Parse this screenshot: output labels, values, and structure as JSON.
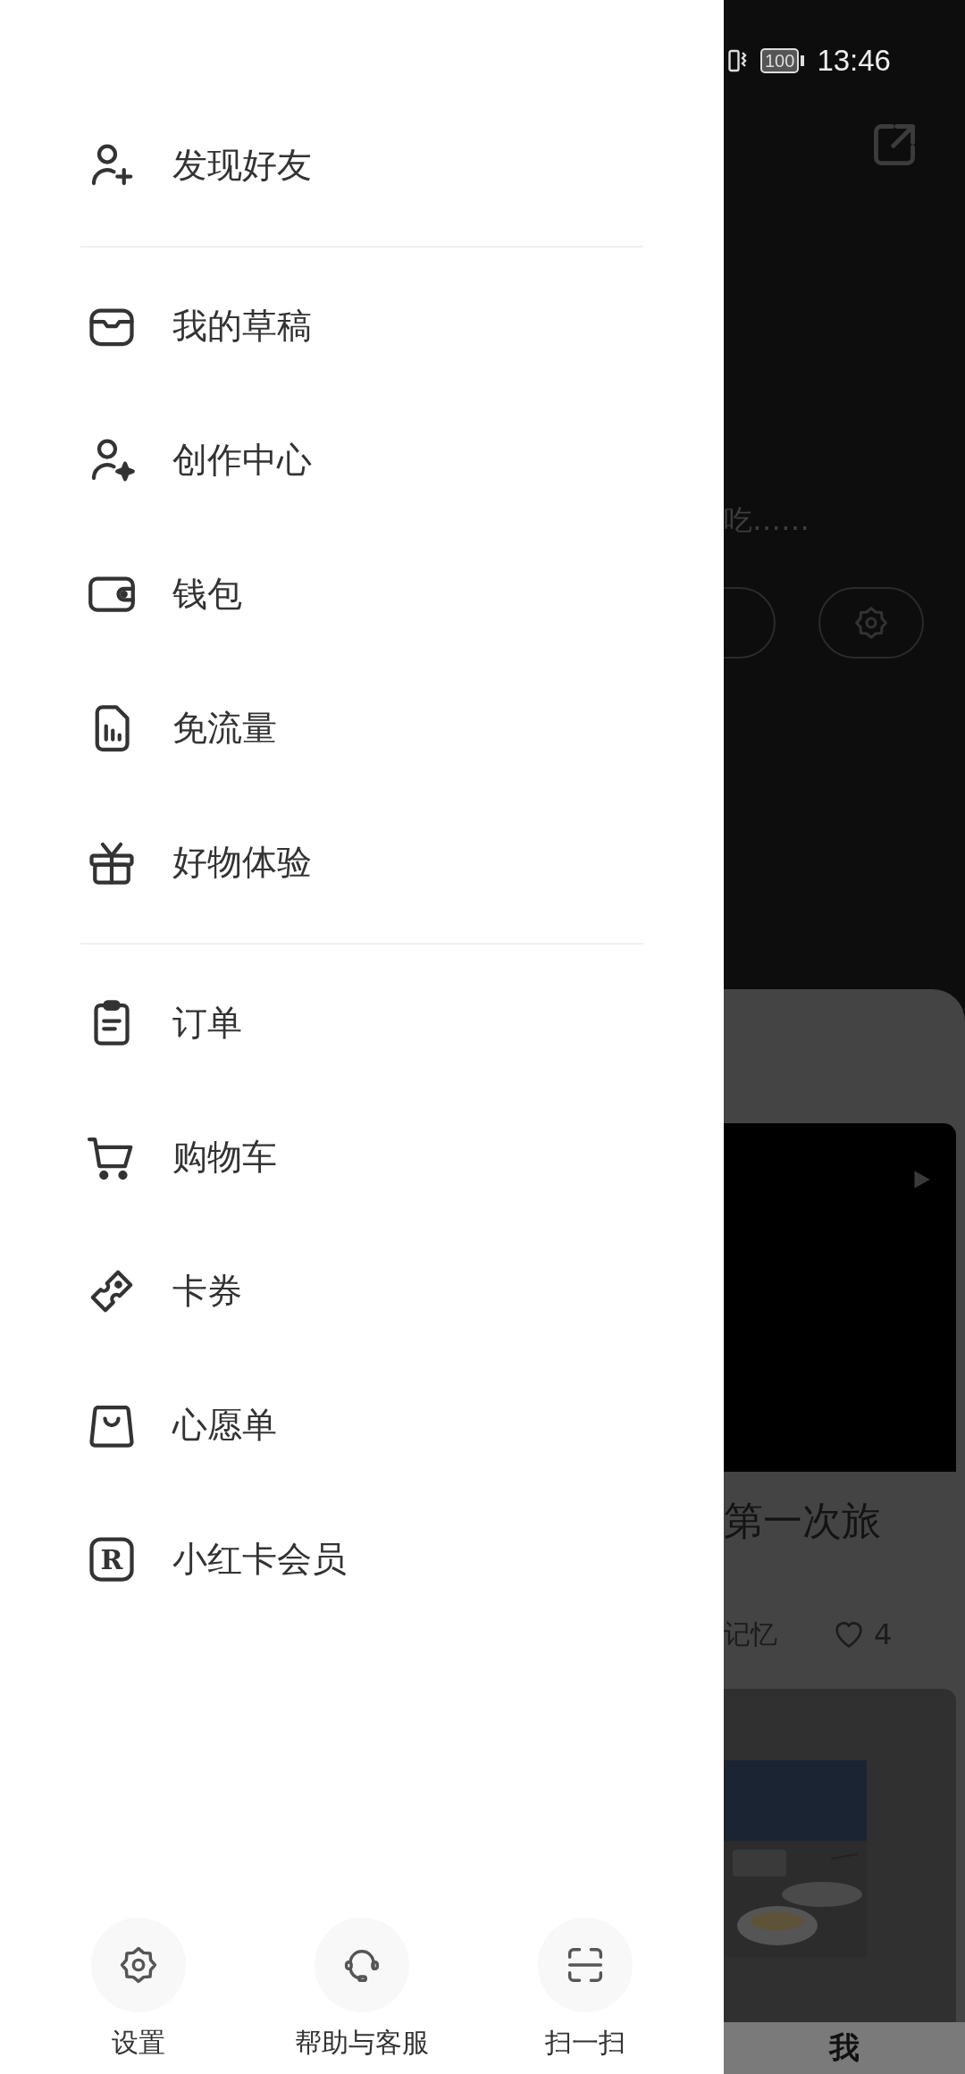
{
  "status_bar": {
    "battery": "100",
    "time": "13:46"
  },
  "drawer": {
    "sections": [
      {
        "items": [
          {
            "label": "发现好友"
          }
        ]
      },
      {
        "items": [
          {
            "label": "我的草稿"
          },
          {
            "label": "创作中心"
          },
          {
            "label": "钱包"
          },
          {
            "label": "免流量"
          },
          {
            "label": "好物体验"
          }
        ]
      },
      {
        "items": [
          {
            "label": "订单"
          },
          {
            "label": "购物车"
          },
          {
            "label": "卡券"
          },
          {
            "label": "心愿单"
          },
          {
            "label": "小红卡会员",
            "icon_text": "R"
          }
        ]
      }
    ],
    "actions": [
      {
        "label": "设置"
      },
      {
        "label": "帮助与客服"
      },
      {
        "label": "扫一扫"
      }
    ]
  },
  "background_page": {
    "bio_snippet": "吃……",
    "note_card": {
      "title": "第一次旅",
      "author": "记忆",
      "likes": "4"
    },
    "tab_label": "我"
  }
}
